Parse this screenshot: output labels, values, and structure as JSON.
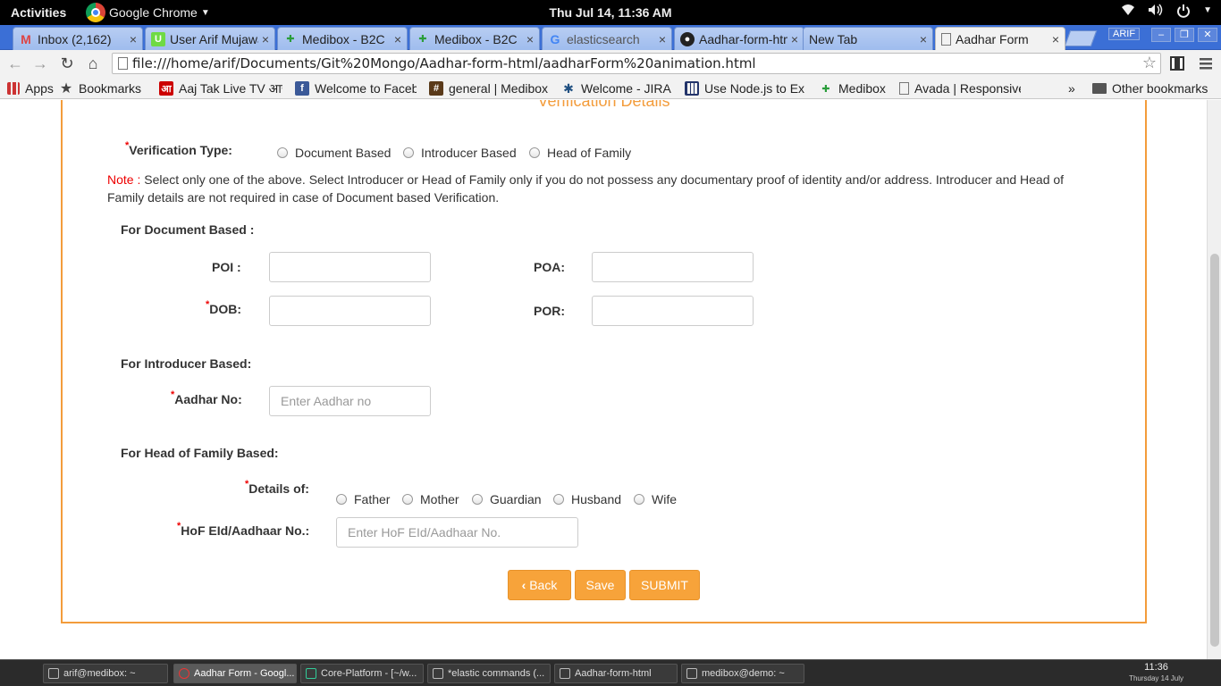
{
  "topbar": {
    "activities": "Activities",
    "app_name": "Google Chrome",
    "datetime": "Thu Jul 14, 11:36 AM"
  },
  "tabs": [
    {
      "label": "Inbox (2,162)",
      "icon": "gmail-icon",
      "close": "×"
    },
    {
      "label": "User Arif Mujawar",
      "icon": "upwork-icon",
      "close": "×"
    },
    {
      "label": "Medibox - B2C",
      "icon": "medibox-icon",
      "close": "×"
    },
    {
      "label": "Medibox - B2C",
      "icon": "medibox-icon",
      "close": "×"
    },
    {
      "label": "elasticsearch",
      "icon": "google-icon",
      "close": "×"
    },
    {
      "label": "Aadhar-form-html",
      "icon": "github-icon",
      "close": "×"
    },
    {
      "label": "New Tab",
      "icon": "",
      "close": "×"
    },
    {
      "label": "Aadhar Form",
      "icon": "page-icon",
      "close": "×"
    }
  ],
  "window": {
    "user": "ARIF"
  },
  "address": {
    "url": "file:///home/arif/Documents/Git%20Mongo/Aadhar-form-html/aadharForm%20animation.html"
  },
  "bookmarks": [
    {
      "label": "Apps",
      "icon": "apps-grid-icon"
    },
    {
      "label": "Bookmarks",
      "icon": "star-icon"
    },
    {
      "label": "Aaj Tak Live TV आज",
      "icon": "aajtak-icon"
    },
    {
      "label": "Welcome to Facebook",
      "icon": "facebook-icon"
    },
    {
      "label": "general | Medibox",
      "icon": "slack-icon"
    },
    {
      "label": "Welcome - JIRA",
      "icon": "jira-icon"
    },
    {
      "label": "Use Node.js to Ex",
      "icon": "grid-icon"
    },
    {
      "label": "Medibox",
      "icon": "medibox-icon"
    },
    {
      "label": "Avada | Responsive",
      "icon": "page-icon"
    },
    {
      "label": "»",
      "icon": ""
    },
    {
      "label": "Other bookmarks",
      "icon": "folder-icon"
    }
  ],
  "form": {
    "section_title": "Verification Details",
    "verification_type_label": "Verification Type:",
    "verification_options": [
      "Document Based",
      "Introducer Based",
      "Head of Family"
    ],
    "note_label": "Note :",
    "note_text": " Select only one of the above. Select Introducer or Head of Family only if you do not possess any documentary proof of identity and/or address. Introducer and Head of Family details are not required in case of Document based Verification.",
    "document_section": "For Document Based :",
    "poi_label": "POI :",
    "poa_label": "POA:",
    "dob_label": "DOB:",
    "por_label": "POR:",
    "introducer_section": "For Introducer Based:",
    "aadhar_label": "Aadhar No:",
    "aadhar_placeholder": "Enter Aadhar no",
    "hof_section": "For Head of Family Based:",
    "details_of_label": "Details of:",
    "details_options": [
      "Father",
      "Mother",
      "Guardian",
      "Husband",
      "Wife"
    ],
    "hof_label": "HoF EId/Aadhaar No.:",
    "hof_placeholder": "Enter HoF EId/Aadhaar No.",
    "required_mark": "*",
    "back_label": "Back",
    "save_label": "Save",
    "submit_label": "SUBMIT",
    "accent_color": "#f39c3b",
    "button_color": "#f7a33a"
  },
  "taskbar": {
    "items": [
      "arif@medibox: ~",
      "Aadhar Form - Googl...",
      "Core-Platform - [~/w...",
      "*elastic commands (...",
      "Aadhar-form-html",
      "medibox@demo: ~"
    ],
    "time": "11:36",
    "date": "Thursday 14 July"
  }
}
